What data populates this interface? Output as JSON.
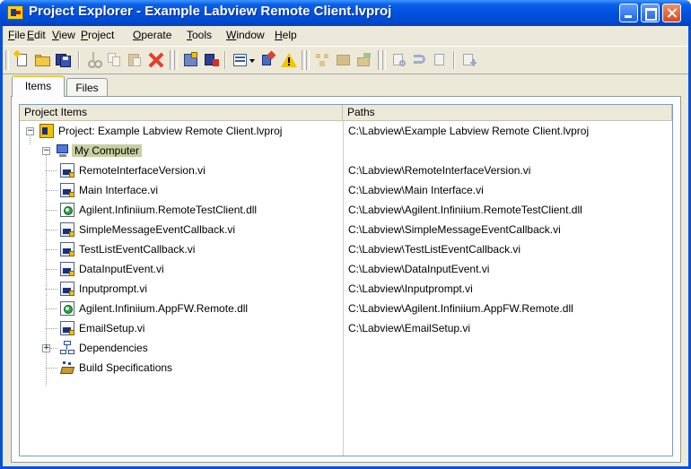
{
  "window": {
    "title": "Project Explorer - Example Labview Remote Client.lvproj"
  },
  "menu": [
    "File",
    "Edit",
    "View",
    "Project",
    "Operate",
    "Tools",
    "Window",
    "Help"
  ],
  "toolbar": {
    "buttons": [
      "new-icon",
      "open-icon",
      "save-all-icon",
      "cut-icon",
      "copy-icon",
      "paste-icon",
      "delete-icon",
      "project-properties-icon",
      "build-icon",
      "view-options-icon",
      "dropdown-arrow-icon",
      "run-icon",
      "warning-icon",
      "dependencies-icon",
      "build-spec-icon",
      "deploy-icon",
      "filter-icon",
      "undo-icon",
      "redo-icon",
      "add-icon"
    ]
  },
  "tabs": [
    "Items",
    "Files"
  ],
  "tree": {
    "columns": [
      "Project Items",
      "Paths"
    ],
    "project": {
      "label": "Project: Example Labview Remote Client.lvproj",
      "path": "C:\\Labview\\Example Labview Remote Client.lvproj"
    },
    "computer": {
      "label": "My Computer"
    },
    "items": [
      {
        "label": "RemoteInterfaceVersion.vi",
        "path": "C:\\Labview\\RemoteInterfaceVersion.vi",
        "icon": "vi-icon"
      },
      {
        "label": "Main Interface.vi",
        "path": "C:\\Labview\\Main Interface.vi",
        "icon": "vi-icon"
      },
      {
        "label": "Agilent.Infiniium.RemoteTestClient.dll",
        "path": "C:\\Labview\\Agilent.Infiniium.RemoteTestClient.dll",
        "icon": "dll-icon"
      },
      {
        "label": "SimpleMessageEventCallback.vi",
        "path": "C:\\Labview\\SimpleMessageEventCallback.vi",
        "icon": "vi-icon"
      },
      {
        "label": "TestListEventCallback.vi",
        "path": "C:\\Labview\\TestListEventCallback.vi",
        "icon": "vi-icon"
      },
      {
        "label": "DataInputEvent.vi",
        "path": "C:\\Labview\\DataInputEvent.vi",
        "icon": "vi-icon"
      },
      {
        "label": "Inputprompt.vi",
        "path": "C:\\Labview\\Inputprompt.vi",
        "icon": "vi-icon"
      },
      {
        "label": "Agilent.Infiniium.AppFW.Remote.dll",
        "path": "C:\\Labview\\Agilent.Infiniium.AppFW.Remote.dll",
        "icon": "dll-icon"
      },
      {
        "label": "EmailSetup.vi",
        "path": "C:\\Labview\\EmailSetup.vi",
        "icon": "vi-icon"
      }
    ],
    "dependencies": {
      "label": "Dependencies"
    },
    "build_specifications": {
      "label": "Build Specifications"
    }
  },
  "colors": {
    "title_bar": "#0351dd",
    "window_face": "#ece9d8",
    "selection_highlight": "#c7cfa0"
  }
}
